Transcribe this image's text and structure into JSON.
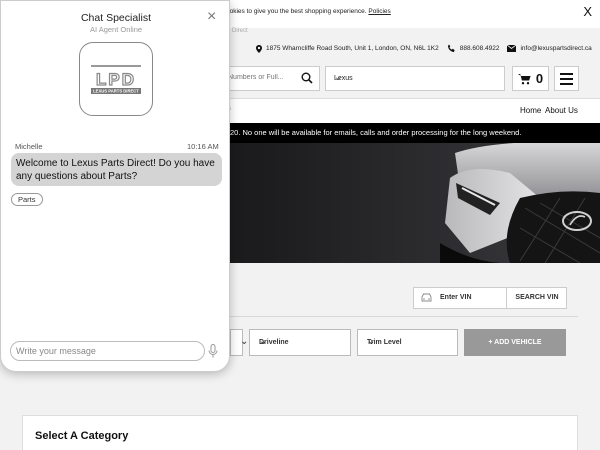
{
  "cookie": {
    "text": "ookies to give you the best shopping experience.",
    "link": "Policies",
    "close": "X"
  },
  "breadcrumb_faded": "Direct",
  "contact": {
    "address": "1875 Wharncliffe Road South, Unit 1, London, ON, N6L 1K2",
    "phone": "888.608.4922",
    "email": "info@lexuspartsdirect.ca"
  },
  "search": {
    "placeholder": "Numbers or Full..."
  },
  "make_select": {
    "value": "Lexus"
  },
  "cart": {
    "count": "0"
  },
  "nav": {
    "faded": "s",
    "items": [
      "Home",
      "About Us"
    ]
  },
  "notice": "20. No one will be available for emails, calls and order processing for the long weekend.",
  "vin": {
    "placeholder": "Enter VIN",
    "button": "SEARCH VIN"
  },
  "filters": {
    "driveline": "Driveline",
    "trim": "Trim Level",
    "add_button": "+ ADD VEHICLE"
  },
  "category": {
    "title": "Select A Category"
  },
  "chat": {
    "title": "Chat Specialist",
    "subtitle": "AI Agent Online",
    "close": "×",
    "logo_text": "LPD",
    "logo_subtext": "LEXUS PARTS DIRECT",
    "sender": "Michelle",
    "time": "10:16 AM",
    "message": "Welcome to Lexus Parts Direct! Do you have any questions about Parts?",
    "chip": "Parts",
    "input_placeholder": "Write your message"
  },
  "colors": {
    "notice_bg": "#000000",
    "bubble_bg": "#d4d4d4",
    "add_vehicle_bg": "#999999",
    "chat_bg": "#ffffff"
  }
}
